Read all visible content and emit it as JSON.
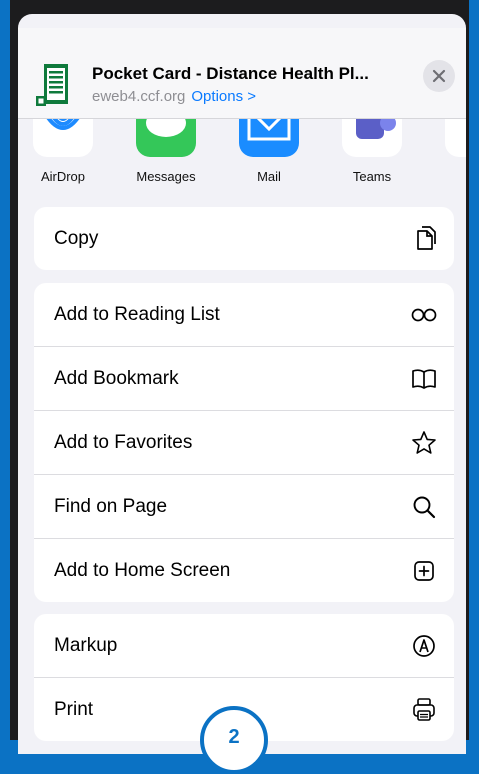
{
  "header": {
    "title": "Pocket Card - Distance Health Pl...",
    "domain": "eweb4.ccf.org",
    "options_label": "Options >",
    "close_icon": "close-icon"
  },
  "apps": [
    {
      "label": "AirDrop",
      "icon": "airdrop-icon",
      "color": "#1e8bff"
    },
    {
      "label": "Messages",
      "icon": "messages-icon",
      "color": "#34c759"
    },
    {
      "label": "Mail",
      "icon": "mail-icon",
      "color": "#1a8cff"
    },
    {
      "label": "Teams",
      "icon": "teams-icon",
      "color": "#5b5fc7"
    }
  ],
  "groups": [
    {
      "items": [
        {
          "label": "Copy",
          "icon": "copy-icon"
        }
      ]
    },
    {
      "items": [
        {
          "label": "Add to Reading List",
          "icon": "glasses-icon"
        },
        {
          "label": "Add Bookmark",
          "icon": "book-icon"
        },
        {
          "label": "Add to Favorites",
          "icon": "star-icon"
        },
        {
          "label": "Find on Page",
          "icon": "search-icon"
        },
        {
          "label": "Add to Home Screen",
          "icon": "add-square-icon"
        }
      ]
    },
    {
      "items": [
        {
          "label": "Markup",
          "icon": "markup-icon"
        },
        {
          "label": "Print",
          "icon": "printer-icon"
        }
      ]
    }
  ],
  "badge": {
    "number": "2"
  },
  "colors": {
    "accent": "#0a7aff",
    "frame": "#0b72c4",
    "sheet_bg": "#f2f2f7"
  }
}
